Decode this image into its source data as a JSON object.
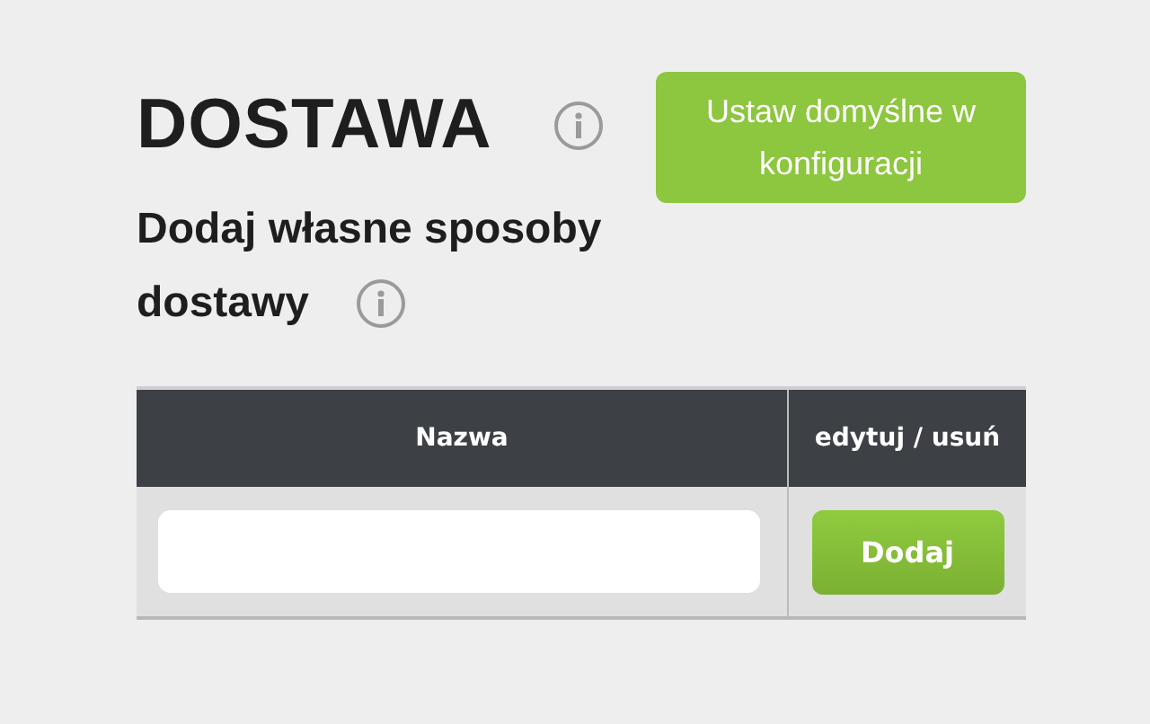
{
  "title": "DOSTAWA",
  "default_button": "Ustaw domyślne w konfiguracji",
  "subtitle_lines": [
    "Dodaj własne sposoby",
    "dostawy"
  ],
  "table": {
    "columns": [
      "Nazwa",
      "edytuj / usuń"
    ],
    "rows": [
      {
        "name_field": {},
        "action_button": "Dodaj"
      }
    ]
  }
}
